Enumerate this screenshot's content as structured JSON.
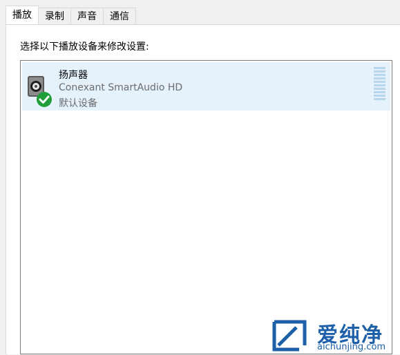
{
  "tabs": [
    {
      "label": "播放",
      "active": true
    },
    {
      "label": "录制",
      "active": false
    },
    {
      "label": "声音",
      "active": false
    },
    {
      "label": "通信",
      "active": false
    }
  ],
  "instruction": "选择以下播放设备来修改设置:",
  "devices": [
    {
      "name": "扬声器",
      "description": "Conexant SmartAudio HD",
      "status": "默认设备",
      "icon": "speaker-icon",
      "default": true,
      "selected": true,
      "level": 0
    }
  ],
  "watermark": {
    "brand": "爱纯净",
    "url": "aichunjing.com"
  },
  "colors": {
    "selection": "#e5f1fb",
    "meter": "#b8d6ec",
    "check": "#1f9e3b",
    "watermark": "#1d5fa8"
  }
}
